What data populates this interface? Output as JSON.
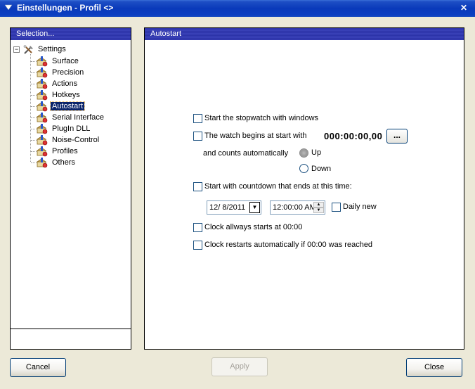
{
  "window": {
    "title": "Einstellungen - Profil <>",
    "close_glyph": "✕"
  },
  "sidebar": {
    "header": "Selection...",
    "root_label": "Settings",
    "root_expander": "−",
    "items": [
      {
        "label": "Surface"
      },
      {
        "label": "Precision"
      },
      {
        "label": "Actions"
      },
      {
        "label": "Hotkeys"
      },
      {
        "label": "Autostart",
        "selected": true
      },
      {
        "label": "Serial Interface"
      },
      {
        "label": "PlugIn DLL"
      },
      {
        "label": "Noise-Control"
      },
      {
        "label": "Profiles"
      },
      {
        "label": "Others"
      }
    ]
  },
  "main": {
    "header": "Autostart",
    "start_with_windows": "Start the stopwatch with windows",
    "watch_begins": "The watch begins at start with",
    "start_time": "000:00:00,00",
    "browse_label": "...",
    "counts_auto": "and counts automatically",
    "up_label": "Up",
    "down_label": "Down",
    "countdown": "Start with countdown that ends at this time:",
    "date_value": "12/  8/2011",
    "time_value": "12:00:00 AM",
    "daily_new": "Daily new",
    "clock_starts": "Clock allways starts at 00:00",
    "clock_restarts": "Clock restarts automatically if 00:00 was reached"
  },
  "footer": {
    "cancel": "Cancel",
    "apply": "Apply",
    "close": "Close"
  },
  "icons": {
    "tree_item": "settings-gear-icon",
    "root": "tools-icon"
  }
}
